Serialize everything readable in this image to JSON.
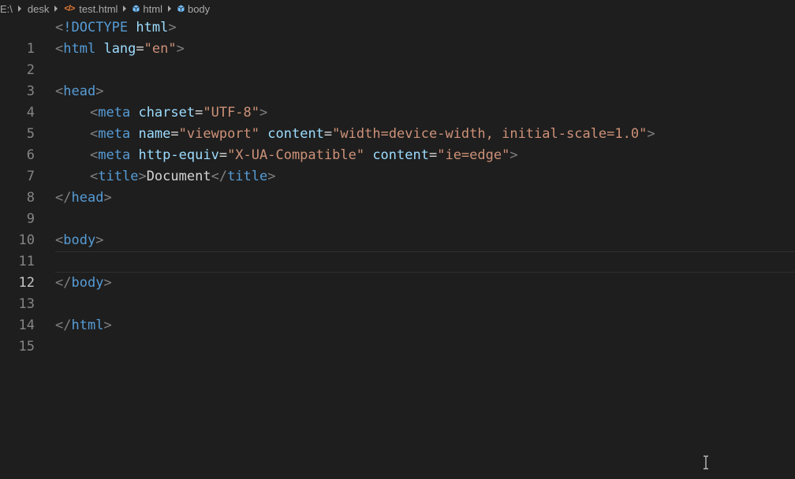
{
  "breadcrumb": {
    "items": [
      {
        "label": "E:\\"
      },
      {
        "label": "desk"
      },
      {
        "label": "test.html",
        "icon": "html-file-icon"
      },
      {
        "label": "html",
        "icon": "element-cube-icon"
      },
      {
        "label": "body",
        "icon": "element-cube-icon"
      }
    ],
    "file_icon_glyph": "</>"
  },
  "editor": {
    "lines": [
      {
        "number": "1"
      },
      {
        "number": "2"
      },
      {
        "number": "3"
      },
      {
        "number": "4"
      },
      {
        "number": "5"
      },
      {
        "number": "6"
      },
      {
        "number": "7"
      },
      {
        "number": "8"
      },
      {
        "number": "9"
      },
      {
        "number": "10"
      },
      {
        "number": "11"
      },
      {
        "number": "12"
      },
      {
        "number": "13"
      },
      {
        "number": "14"
      },
      {
        "number": "15"
      }
    ],
    "current_line": "12",
    "tokens": {
      "lt": "<",
      "gt": ">",
      "lt_slash": "</",
      "eq": "=",
      "doctype": "!DOCTYPE",
      "html": "html",
      "lang": "lang",
      "en": "\"en\"",
      "head": "head",
      "meta": "meta",
      "charset": "charset",
      "utf8": "\"UTF-8\"",
      "name": "name",
      "viewport": "\"viewport\"",
      "content": "content",
      "viewport_content": "\"width=device-width, initial-scale=1.0\"",
      "http_equiv": "http-equiv",
      "xua": "\"X-UA-Compatible\"",
      "ie_edge": "\"ie=edge\"",
      "title": "title",
      "document": "Document",
      "body": "body"
    }
  },
  "colors": {
    "background": "#1e1e1e",
    "tag": "#569cd6",
    "attribute": "#9cdcfe",
    "string": "#ce9178",
    "bracket": "#808080",
    "line_number": "#858585"
  }
}
